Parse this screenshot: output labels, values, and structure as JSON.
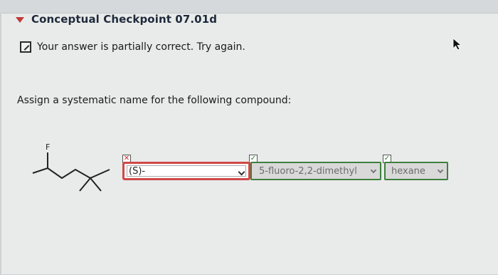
{
  "header": {
    "title": "Conceptual Checkpoint 07.01d"
  },
  "status": {
    "text": "Your answer is partially correct.  Try again."
  },
  "question": {
    "prompt": "Assign a systematic name for the following compound:",
    "atom_label": "F"
  },
  "answer": {
    "stereo": "(S)-",
    "substituents": "5-fluoro-2,2-dimethyl",
    "parent": "hexane"
  },
  "marks": {
    "wrong": "✕",
    "right": "✓"
  }
}
